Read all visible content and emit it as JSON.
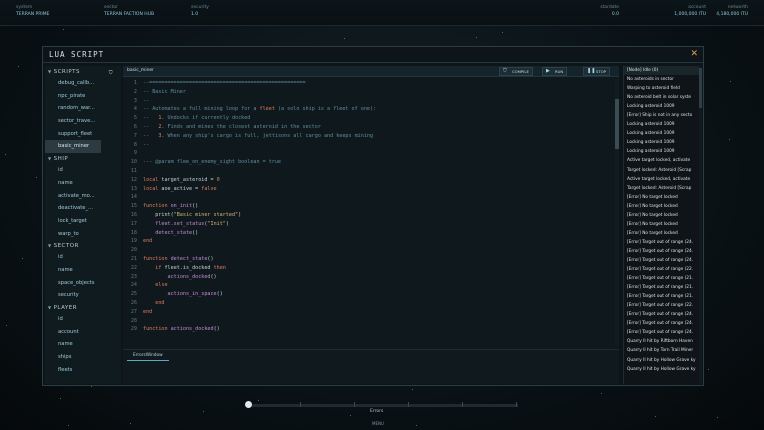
{
  "topbar": {
    "system": {
      "label": "system",
      "value": "TERRAN PRIME"
    },
    "sector": {
      "label": "sector",
      "value": "TERRAN FACTION HUB"
    },
    "security": {
      "label": "security",
      "value": "1.0"
    },
    "stardate": {
      "label": "stardate",
      "value": "0.0"
    },
    "account": {
      "label": "account",
      "value": "1,000,000 ITU"
    },
    "networth": {
      "label": "networth",
      "value": "4,180,000 ITU"
    }
  },
  "window": {
    "title": "LUA SCRIPT",
    "close_icon": "close-icon"
  },
  "sidebar": {
    "sections": [
      {
        "name": "SCRIPTS",
        "items": [
          "debug_callb...",
          "npc_pirate",
          "random_war...",
          "sector_trave...",
          "support_fleet",
          "basic_miner"
        ],
        "selected": 5
      },
      {
        "name": "SHIP",
        "items": [
          "id",
          "name",
          "activate_mo...",
          "deactivate_...",
          "lock_target",
          "warp_to"
        ]
      },
      {
        "name": "SECTOR",
        "items": [
          "id",
          "name",
          "space_objects",
          "security"
        ]
      },
      {
        "name": "PLAYER",
        "items": [
          "id",
          "account",
          "name",
          "ships",
          "fleets"
        ]
      }
    ]
  },
  "editor": {
    "tab": "basic_miner",
    "buttons": {
      "compile": "COMPILE",
      "run": "RUN",
      "stop": "STOP"
    },
    "lines": [
      {
        "n": "1",
        "t": [
          [
            "cm",
            "--==================================================="
          ]
        ]
      },
      {
        "n": "2",
        "t": [
          [
            "cm",
            "-- Basic Miner"
          ]
        ]
      },
      {
        "n": "3",
        "t": [
          [
            "cm",
            "--"
          ]
        ]
      },
      {
        "n": "4",
        "t": [
          [
            "cm",
            "-- Automates a full mining loop for a "
          ],
          [
            "kw",
            "fleet"
          ],
          [
            "cm",
            " (a solo ship is a fleet of one):"
          ]
        ]
      },
      {
        "n": "5",
        "t": [
          [
            "cm",
            "--   "
          ],
          [
            "nb",
            "1."
          ],
          [
            "cm",
            " Undocks if currently docked"
          ]
        ]
      },
      {
        "n": "6",
        "t": [
          [
            "cm",
            "--   "
          ],
          [
            "nb",
            "2."
          ],
          [
            "cm",
            " Finds and mines the closest asteroid in the sector"
          ]
        ]
      },
      {
        "n": "7",
        "t": [
          [
            "cm",
            "--   "
          ],
          [
            "nb",
            "3."
          ],
          [
            "cm",
            " When any ship's cargo is full, jettisons all cargo and keeps mining"
          ]
        ]
      },
      {
        "n": "8",
        "t": [
          [
            "cm",
            "--"
          ]
        ]
      },
      {
        "n": "9",
        "t": [
          [
            "pl",
            ""
          ]
        ]
      },
      {
        "n": "10",
        "t": [
          [
            "cm",
            "--- @param flee_on_enemy_sight boolean = true"
          ]
        ]
      },
      {
        "n": "11",
        "t": [
          [
            "pl",
            ""
          ]
        ]
      },
      {
        "n": "12",
        "t": [
          [
            "kw",
            "local"
          ],
          [
            "pl",
            " target_asteroid = "
          ],
          [
            "nb",
            "0"
          ]
        ]
      },
      {
        "n": "13",
        "t": [
          [
            "kw",
            "local"
          ],
          [
            "pl",
            " aoe_active = "
          ],
          [
            "kw",
            "false"
          ]
        ]
      },
      {
        "n": "14",
        "t": [
          [
            "pl",
            ""
          ]
        ]
      },
      {
        "n": "15",
        "t": [
          [
            "kw",
            "function"
          ],
          [
            "fn",
            " on_init"
          ],
          [
            "pl",
            "()"
          ]
        ]
      },
      {
        "n": "16",
        "t": [
          [
            "pl",
            "    print("
          ],
          [
            "st",
            "\"Basic miner started\""
          ],
          [
            "pl",
            ")"
          ]
        ]
      },
      {
        "n": "17",
        "t": [
          [
            "pl",
            "    "
          ],
          [
            "fn",
            "fleet.set_status"
          ],
          [
            "pl",
            "("
          ],
          [
            "st",
            "\"Init\""
          ],
          [
            "pl",
            ")"
          ]
        ]
      },
      {
        "n": "18",
        "t": [
          [
            "pl",
            "    "
          ],
          [
            "fn",
            "detect_state"
          ],
          [
            "pl",
            "()"
          ]
        ]
      },
      {
        "n": "19",
        "t": [
          [
            "kw",
            "end"
          ]
        ]
      },
      {
        "n": "20",
        "t": [
          [
            "pl",
            ""
          ]
        ]
      },
      {
        "n": "21",
        "t": [
          [
            "kw",
            "function"
          ],
          [
            "fn",
            " detect_state"
          ],
          [
            "pl",
            "()"
          ]
        ]
      },
      {
        "n": "22",
        "t": [
          [
            "pl",
            "    "
          ],
          [
            "kw",
            "if"
          ],
          [
            "pl",
            " fleet.is_docked "
          ],
          [
            "kw",
            "then"
          ]
        ]
      },
      {
        "n": "23",
        "t": [
          [
            "pl",
            "        "
          ],
          [
            "fn",
            "actions_docked"
          ],
          [
            "pl",
            "()"
          ]
        ]
      },
      {
        "n": "24",
        "t": [
          [
            "pl",
            "    "
          ],
          [
            "kw",
            "else"
          ]
        ]
      },
      {
        "n": "25",
        "t": [
          [
            "pl",
            "        "
          ],
          [
            "fn",
            "actions_in_space"
          ],
          [
            "pl",
            "()"
          ]
        ]
      },
      {
        "n": "26",
        "t": [
          [
            "pl",
            "    "
          ],
          [
            "kw",
            "end"
          ]
        ]
      },
      {
        "n": "27",
        "t": [
          [
            "kw",
            "end"
          ]
        ]
      },
      {
        "n": "28",
        "t": [
          [
            "pl",
            ""
          ]
        ]
      },
      {
        "n": "29",
        "t": [
          [
            "kw",
            "function"
          ],
          [
            "fn",
            " actions_docked"
          ],
          [
            "pl",
            "()"
          ]
        ]
      }
    ],
    "errors_tab": "ErrorsWindow"
  },
  "log": [
    "[Node] Idle (0)",
    "No asteroids in sector",
    "Warping to asteroid field",
    "No asteroid belt in solar syste",
    "Locking asteroid 1009",
    "[Error] Ship is not in any secto",
    "Locking asteroid 1009",
    "Locking asteroid 1009",
    "Locking asteroid 1009",
    "Locking asteroid 1009",
    "Active target locked, activate",
    "Target locked: Asteroid [Scrap",
    "Active target locked, activate",
    "Target locked: Asteroid [Scrap",
    "[Error] No target locked",
    "[Error] No target locked",
    "[Error] No target locked",
    "[Error] No target locked",
    "[Error] No target locked",
    "[Error] Target out of range (24.",
    "[Error] Target out of range (24.",
    "[Error] Target out of range (24.",
    "[Error] Target out of range (22.",
    "[Error] Target out of range (21.",
    "[Error] Target out of range (21.",
    "[Error] Target out of range (21.",
    "[Error] Target out of range (22.",
    "[Error] Target out of range (24.",
    "[Error] Target out of range (24.",
    "[Error] Target out of range (24.",
    "Quarry II hit by Riftborn Haven",
    "Quarry II hit by Torn Trail Miner",
    "Quarry II hit by Hollow Grave ky",
    "Quarry II hit by Hollow Grave ky"
  ],
  "bottom": {
    "label": "Errors",
    "menu": "MENU",
    "progress": 0.0
  },
  "icons": {
    "run": "play-icon",
    "stop": "stop-icon",
    "compile": "compile-icon",
    "scripts_header": "shield-icon"
  }
}
